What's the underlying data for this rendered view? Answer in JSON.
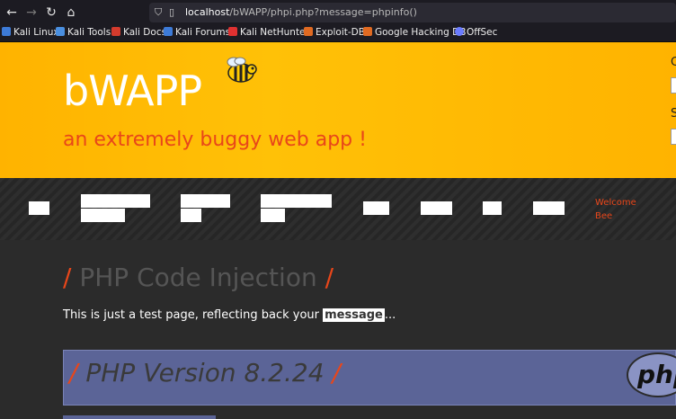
{
  "browser": {
    "url_host": "localhost",
    "url_path": "/bWAPP/phpi.php?message=phpinfo()",
    "bookmarks": [
      "Kali Linux",
      "Kali Tools",
      "Kali Docs",
      "Kali Forums",
      "Kali NetHunter",
      "Exploit-DB",
      "Google Hacking DB",
      "OffSec"
    ]
  },
  "header": {
    "logo": "bWAPP",
    "tagline": "an extremely buggy web app !"
  },
  "nav": {
    "welcome_line1": "Welcome",
    "welcome_line2": "Bee"
  },
  "main": {
    "title": "PHP Code Injection",
    "intro_before": "This is just a test page, reflecting back your ",
    "intro_link": "message",
    "intro_after": "...",
    "php_version": "PHP Version 8.2.24",
    "php_logo": "php"
  },
  "colors": {
    "accent": "#e8461a",
    "header": "#ffb300",
    "php_panel": "#5b6497"
  }
}
